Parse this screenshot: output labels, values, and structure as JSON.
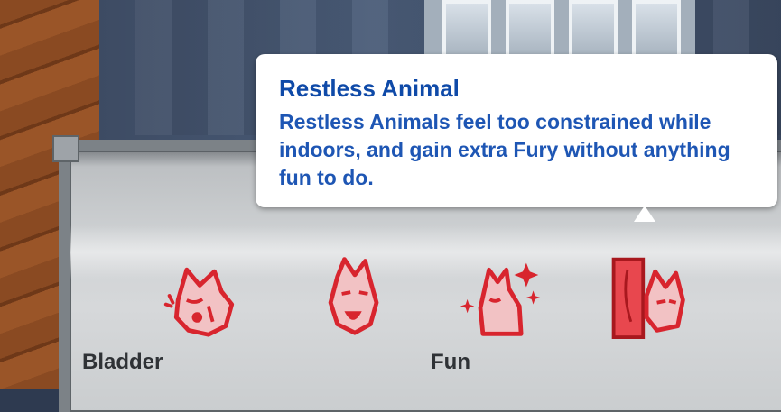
{
  "tooltip": {
    "title": "Restless Animal",
    "description": "Restless Animals feel too constrained while indoors, and gain extra Fury without anything fun to do."
  },
  "needs": [
    {
      "label": "Bladder",
      "icon": "wolf-crying-icon"
    },
    {
      "label": "",
      "icon": "wolf-howling-icon"
    },
    {
      "label": "Fun",
      "icon": "wolf-sparkle-icon"
    },
    {
      "label": "",
      "icon": "wolf-peeking-plank-icon"
    }
  ],
  "colors": {
    "tooltip_title": "#0f4aa8",
    "tooltip_text": "#1e56b4",
    "icon_red": "#d8252e",
    "label_text": "#2f3236"
  }
}
